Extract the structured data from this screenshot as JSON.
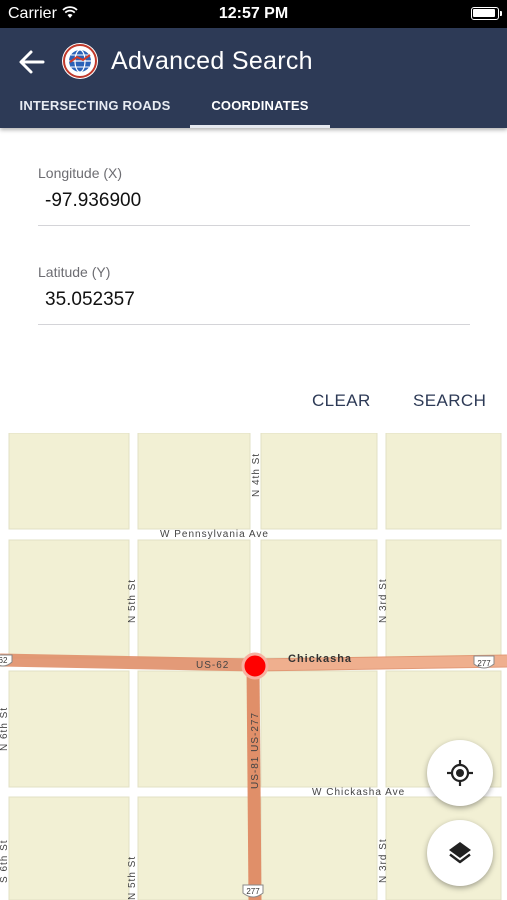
{
  "status_bar": {
    "carrier": "Carrier",
    "time": "12:57 PM"
  },
  "header": {
    "title": "Advanced Search",
    "back_icon": "arrow-left-icon",
    "logo_icon": "globe-logo-icon"
  },
  "tabs": [
    {
      "label": "INTERSECTING ROADS",
      "selected": false
    },
    {
      "label": "COORDINATES",
      "selected": true
    }
  ],
  "form": {
    "longitude": {
      "label": "Longitude (X)",
      "value": "-97.936900"
    },
    "latitude": {
      "label": "Latitude (Y)",
      "value": "35.052357"
    }
  },
  "actions": {
    "clear_label": "CLEAR",
    "search_label": "SEARCH"
  },
  "map": {
    "street_labels": {
      "w_pennsylvania": "W Pennsylvania Ave",
      "w_chickasha": "W Chickasha Ave",
      "n_4th": "N 4th St",
      "n_5th": "N 5th St",
      "n_3rd_upper": "N 3rd St",
      "n_3rd_lower": "N 3rd St",
      "n_6th_upper": "N 6th St",
      "n_6th_lower": "S 6th St",
      "n_5th_lower": "N 5th St",
      "us62": "US-62",
      "us81": "US-81 US-277",
      "chickasha": "Chickasha"
    },
    "shields": {
      "left": "62",
      "right": "277",
      "bottom": "277"
    },
    "colors": {
      "block": "#f2f0d4",
      "highway": "#e3956d",
      "pin": "#ff0000"
    }
  },
  "fabs": {
    "locate_icon": "crosshair-locate-icon",
    "layers_icon": "layers-icon"
  }
}
